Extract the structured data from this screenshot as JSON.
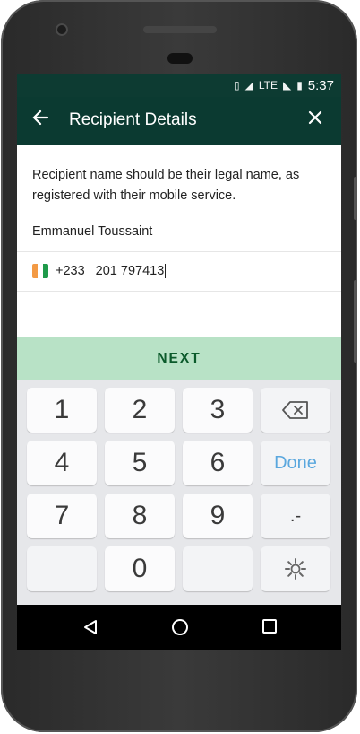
{
  "status_bar": {
    "time": "5:37",
    "network_type": "LTE",
    "icons": [
      "vibrate-icon",
      "signal-icon",
      "wifi-off-icon",
      "battery-icon"
    ]
  },
  "app_bar": {
    "title": "Recipient Details",
    "back_icon": "arrow-left-icon",
    "close_icon": "close-icon"
  },
  "form": {
    "description": "Recipient name should be their legal name, as registered with their mobile service.",
    "recipient_name": "Emmanuel Toussaint",
    "country_code": "+233",
    "phone_number": "201 797413",
    "flag_colors": [
      "#f39a44",
      "#ffffff",
      "#1e9a4a"
    ]
  },
  "next_button": {
    "label": "NEXT"
  },
  "keypad": {
    "keys": [
      "1",
      "2",
      "3",
      "⌫",
      "4",
      "5",
      "6",
      "Done",
      "7",
      "8",
      "9",
      ".-",
      "",
      "0",
      "",
      ""
    ],
    "done_label": "Done"
  },
  "colors": {
    "primary": "#0b3a31",
    "next_bg": "#b8e2c6",
    "next_text": "#0b5a2b",
    "done": "#5aa7de"
  }
}
